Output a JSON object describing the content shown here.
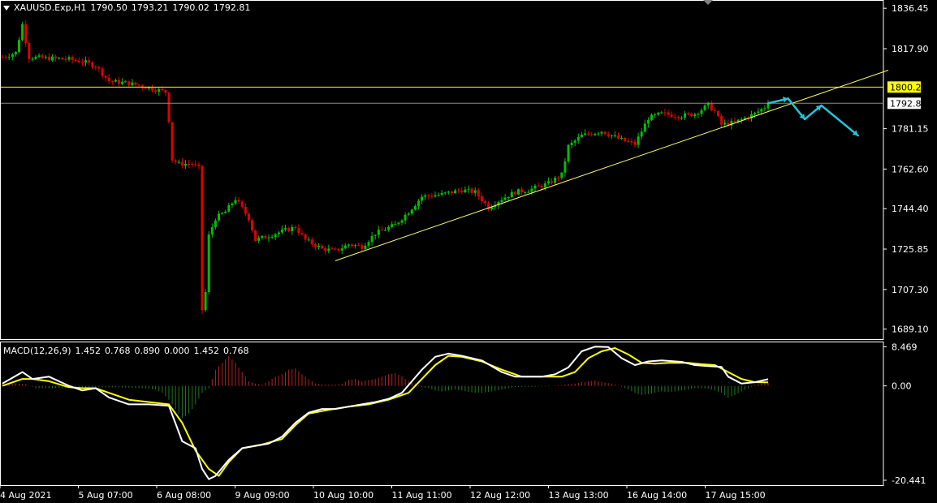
{
  "header": {
    "symbol": "XAUUSD.Exp,H1",
    "open": "1790.50",
    "high": "1793.21",
    "low": "1790.02",
    "close": "1792.81"
  },
  "macd_header": {
    "label": "MACD(12,26,9)",
    "values": [
      "1.452",
      "0.768",
      "0.890",
      "0.000",
      "1.452",
      "0.768"
    ]
  },
  "colors": {
    "background": "#000000",
    "bull": "#00c000",
    "bear": "#e00000",
    "hline": "#ffff00",
    "price_line": "#8a8a8a",
    "trendline": "#ffff66",
    "arrow": "#27c4d9",
    "macd_main": "#ffffff",
    "macd_signal": "#ffff00"
  },
  "chart_data": [
    {
      "type": "candlestick",
      "price_axis_ticks": [
        1836.45,
        1817.9,
        1781.15,
        1762.6,
        1744.4,
        1725.85,
        1707.3,
        1689.1
      ],
      "price_axis_tick_labels": [
        "1836.45",
        "1817.90",
        "1781.15",
        "1762.60",
        "1744.40",
        "1725.85",
        "1707.30",
        "1689.10"
      ],
      "ylim": [
        1684.5,
        1839.5
      ],
      "time_axis_labels": [
        "4 Aug 2021",
        "5 Aug 07:00",
        "6 Aug 08:00",
        "9 Aug 09:00",
        "10 Aug 10:00",
        "11 Aug 11:00",
        "12 Aug 12:00",
        "13 Aug 13:00",
        "16 Aug 14:00",
        "17 Aug 15:00"
      ],
      "price_path": [
        [
          0,
          1814
        ],
        [
          4,
          1816
        ],
        [
          6,
          1829
        ],
        [
          8,
          1814
        ],
        [
          20,
          1813
        ],
        [
          24,
          1812
        ],
        [
          28,
          1810
        ],
        [
          32,
          1803
        ],
        [
          38,
          1802
        ],
        [
          44,
          1800
        ],
        [
          49,
          1798
        ],
        [
          50,
          1785
        ],
        [
          51,
          1767
        ],
        [
          53,
          1765
        ],
        [
          57,
          1765
        ],
        [
          59,
          1763
        ],
        [
          60,
          1698
        ],
        [
          61,
          1706
        ],
        [
          62,
          1732
        ],
        [
          64,
          1740
        ],
        [
          67,
          1743
        ],
        [
          70,
          1749
        ],
        [
          74,
          1740
        ],
        [
          76,
          1730
        ],
        [
          80,
          1732
        ],
        [
          84,
          1734
        ],
        [
          88,
          1736
        ],
        [
          91,
          1730
        ],
        [
          96,
          1726
        ],
        [
          100,
          1725
        ],
        [
          104,
          1728
        ],
        [
          108,
          1727
        ],
        [
          112,
          1733
        ],
        [
          118,
          1737
        ],
        [
          122,
          1743
        ],
        [
          126,
          1750
        ],
        [
          132,
          1751
        ],
        [
          138,
          1753
        ],
        [
          142,
          1752
        ],
        [
          146,
          1745
        ],
        [
          150,
          1749
        ],
        [
          154,
          1752
        ],
        [
          158,
          1753
        ],
        [
          164,
          1756
        ],
        [
          168,
          1760
        ],
        [
          170,
          1773
        ],
        [
          174,
          1778
        ],
        [
          180,
          1780
        ],
        [
          186,
          1776
        ],
        [
          190,
          1774
        ],
        [
          194,
          1786
        ],
        [
          198,
          1788
        ],
        [
          204,
          1787
        ],
        [
          208,
          1788
        ],
        [
          212,
          1792
        ],
        [
          214,
          1789
        ],
        [
          216,
          1783
        ],
        [
          220,
          1784
        ],
        [
          226,
          1788
        ],
        [
          230,
          1792
        ]
      ],
      "horizontal_level": {
        "value": 1800.26,
        "label": "1800.26"
      },
      "current_price": {
        "value": 1792.81,
        "label": "1792.81"
      },
      "trendline": {
        "points": [
          [
            100,
            1720.5
          ],
          [
            230,
            1789
          ]
        ],
        "extends_right": true
      },
      "projection_arrows": [
        [
          230,
          1792.8
        ],
        [
          236,
          1795.0
        ],
        [
          241,
          1785.5
        ],
        [
          246,
          1791.8
        ],
        [
          257,
          1778.0
        ]
      ]
    },
    {
      "type": "macd",
      "params": "12,26,9",
      "axis_ticks": [
        8.469,
        0.0,
        -20.441
      ],
      "axis_tick_labels": [
        "8.469",
        "0.00",
        "-20.441"
      ],
      "ylim": [
        -21.5,
        9.6
      ],
      "main": [
        [
          0,
          0.5
        ],
        [
          6,
          3
        ],
        [
          9,
          1.5
        ],
        [
          14,
          2
        ],
        [
          20,
          0
        ],
        [
          24,
          -1
        ],
        [
          28,
          -0.5
        ],
        [
          32,
          -2.5
        ],
        [
          38,
          -4
        ],
        [
          44,
          -4
        ],
        [
          50,
          -4.3
        ],
        [
          54,
          -12
        ],
        [
          58,
          -13.5
        ],
        [
          60,
          -18
        ],
        [
          62,
          -20.2
        ],
        [
          64,
          -19.5
        ],
        [
          68,
          -16
        ],
        [
          72,
          -13.5
        ],
        [
          76,
          -13
        ],
        [
          80,
          -12.5
        ],
        [
          84,
          -11
        ],
        [
          88,
          -8
        ],
        [
          92,
          -5.8
        ],
        [
          96,
          -5
        ],
        [
          100,
          -5
        ],
        [
          104,
          -4.5
        ],
        [
          108,
          -4
        ],
        [
          112,
          -3.5
        ],
        [
          116,
          -2.8
        ],
        [
          120,
          -1.5
        ],
        [
          126,
          3.5
        ],
        [
          130,
          6.3
        ],
        [
          134,
          7.0
        ],
        [
          138,
          6.5
        ],
        [
          144,
          5.5
        ],
        [
          150,
          3
        ],
        [
          154,
          2
        ],
        [
          158,
          2
        ],
        [
          162,
          2
        ],
        [
          166,
          2.5
        ],
        [
          170,
          4
        ],
        [
          174,
          7.5
        ],
        [
          178,
          8.5
        ],
        [
          182,
          8.4
        ],
        [
          186,
          6
        ],
        [
          190,
          4.5
        ],
        [
          194,
          5.3
        ],
        [
          198,
          5.5
        ],
        [
          204,
          5.2
        ],
        [
          208,
          4.5
        ],
        [
          212,
          4.3
        ],
        [
          216,
          4.1
        ],
        [
          218,
          2
        ],
        [
          222,
          0.5
        ],
        [
          226,
          0.8
        ],
        [
          230,
          1.452
        ]
      ],
      "signal": [
        [
          0,
          0
        ],
        [
          6,
          1.5
        ],
        [
          9,
          1.5
        ],
        [
          14,
          1
        ],
        [
          20,
          -0.3
        ],
        [
          24,
          -0.5
        ],
        [
          28,
          -0.5
        ],
        [
          32,
          -1.5
        ],
        [
          38,
          -3
        ],
        [
          44,
          -3.5
        ],
        [
          50,
          -4
        ],
        [
          54,
          -8
        ],
        [
          58,
          -14
        ],
        [
          62,
          -18
        ],
        [
          65,
          -19.5
        ],
        [
          68,
          -16.5
        ],
        [
          72,
          -13.5
        ],
        [
          78,
          -12.7
        ],
        [
          84,
          -11.5
        ],
        [
          88,
          -8.5
        ],
        [
          92,
          -6
        ],
        [
          98,
          -5.2
        ],
        [
          104,
          -4.5
        ],
        [
          110,
          -4
        ],
        [
          116,
          -3
        ],
        [
          122,
          -1.5
        ],
        [
          126,
          1.5
        ],
        [
          130,
          4.5
        ],
        [
          134,
          6.5
        ],
        [
          138,
          6.3
        ],
        [
          144,
          5.3
        ],
        [
          150,
          3.5
        ],
        [
          156,
          2
        ],
        [
          162,
          2
        ],
        [
          168,
          2
        ],
        [
          172,
          3
        ],
        [
          176,
          6
        ],
        [
          180,
          7.5
        ],
        [
          184,
          8.2
        ],
        [
          188,
          6.8
        ],
        [
          192,
          5
        ],
        [
          196,
          4.8
        ],
        [
          200,
          5
        ],
        [
          206,
          5
        ],
        [
          210,
          4.7
        ],
        [
          214,
          4.5
        ],
        [
          218,
          3
        ],
        [
          222,
          1.5
        ],
        [
          226,
          0.8
        ],
        [
          230,
          0.768
        ]
      ],
      "histogram": [
        [
          0,
          0.3
        ],
        [
          4,
          0.5
        ],
        [
          7,
          0.4
        ],
        [
          10,
          -0.5
        ],
        [
          14,
          -0.5
        ],
        [
          18,
          -0.5
        ],
        [
          22,
          -0.4
        ],
        [
          26,
          -0.3
        ],
        [
          30,
          -0.3
        ],
        [
          34,
          -0.3
        ],
        [
          38,
          -0.4
        ],
        [
          42,
          -0.5
        ],
        [
          46,
          -0.8
        ],
        [
          48,
          -1.5
        ],
        [
          50,
          -3
        ],
        [
          52,
          -5
        ],
        [
          54,
          -7
        ],
        [
          56,
          -6
        ],
        [
          58,
          -4
        ],
        [
          60,
          -1.5
        ],
        [
          62,
          -0.5
        ],
        [
          64,
          3.5
        ],
        [
          66,
          5
        ],
        [
          68,
          6.5
        ],
        [
          70,
          5
        ],
        [
          72,
          3
        ],
        [
          74,
          1
        ],
        [
          76,
          0.5
        ],
        [
          78,
          0.3
        ],
        [
          80,
          1
        ],
        [
          82,
          2
        ],
        [
          84,
          2.5
        ],
        [
          86,
          3.5
        ],
        [
          88,
          3.8
        ],
        [
          90,
          2.5
        ],
        [
          92,
          1.5
        ],
        [
          94,
          0.5
        ],
        [
          96,
          0.3
        ],
        [
          98,
          0.3
        ],
        [
          100,
          0.3
        ],
        [
          102,
          0.5
        ],
        [
          104,
          1.3
        ],
        [
          106,
          1.5
        ],
        [
          108,
          1
        ],
        [
          110,
          1.3
        ],
        [
          112,
          1.5
        ],
        [
          114,
          2
        ],
        [
          116,
          2.5
        ],
        [
          118,
          2.8
        ],
        [
          120,
          2
        ],
        [
          122,
          1
        ],
        [
          124,
          0.5
        ],
        [
          126,
          -0.3
        ],
        [
          128,
          -0.5
        ],
        [
          130,
          -1
        ],
        [
          132,
          -1.2
        ],
        [
          134,
          -1
        ],
        [
          136,
          -0.8
        ],
        [
          138,
          -1
        ],
        [
          140,
          -1.3
        ],
        [
          142,
          -1.5
        ],
        [
          144,
          -1.5
        ],
        [
          146,
          -1.3
        ],
        [
          148,
          -1.1
        ],
        [
          150,
          -0.8
        ],
        [
          152,
          -0.5
        ],
        [
          154,
          -0.3
        ],
        [
          156,
          -0.2
        ],
        [
          158,
          -0.2
        ],
        [
          160,
          -0.2
        ],
        [
          162,
          -0.1
        ],
        [
          164,
          -0.1
        ],
        [
          166,
          0.1
        ],
        [
          168,
          0.2
        ],
        [
          170,
          0.4
        ],
        [
          172,
          0.5
        ],
        [
          174,
          0.8
        ],
        [
          176,
          1
        ],
        [
          178,
          1.2
        ],
        [
          180,
          0.8
        ],
        [
          182,
          0.6
        ],
        [
          184,
          0.3
        ],
        [
          186,
          -0.2
        ],
        [
          188,
          -0.8
        ],
        [
          190,
          -1.5
        ],
        [
          192,
          -2
        ],
        [
          194,
          -1.8
        ],
        [
          196,
          -1.5
        ],
        [
          198,
          -1.2
        ],
        [
          200,
          -1.3
        ],
        [
          202,
          -1.2
        ],
        [
          204,
          -1
        ],
        [
          206,
          -0.8
        ],
        [
          208,
          -0.5
        ],
        [
          210,
          -0.5
        ],
        [
          212,
          -0.6
        ],
        [
          214,
          -1
        ],
        [
          216,
          -1.5
        ],
        [
          218,
          -2.5
        ],
        [
          220,
          -2
        ],
        [
          222,
          -1.2
        ],
        [
          224,
          -0.5
        ],
        [
          226,
          0.2
        ],
        [
          228,
          0.5
        ],
        [
          230,
          0.68
        ]
      ]
    }
  ]
}
